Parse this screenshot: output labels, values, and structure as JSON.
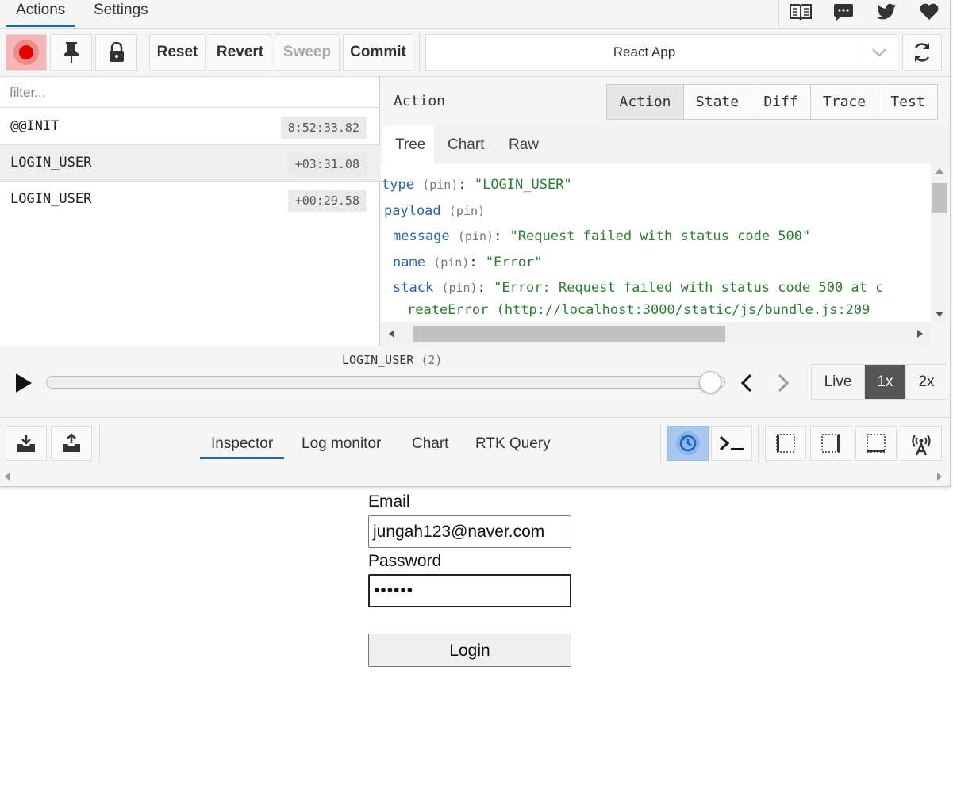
{
  "devtools": {
    "top_tabs": [
      {
        "label": "Actions",
        "active": true
      },
      {
        "label": "Settings",
        "active": false
      }
    ],
    "top_icons": [
      "book-open-icon",
      "chat-icon",
      "twitter-icon",
      "heart-icon"
    ],
    "toolbar": {
      "record_icon": "record-icon",
      "pin_icon": "pin-icon",
      "lock_icon": "lock-icon",
      "reset_label": "Reset",
      "revert_label": "Revert",
      "sweep_label": "Sweep",
      "commit_label": "Commit",
      "instance_select": "React App",
      "sync_icon": "sync-icon"
    },
    "filter_placeholder": "filter...",
    "actions": [
      {
        "name": "@@INIT",
        "time": "8:52:33.82"
      },
      {
        "name": "LOGIN_USER",
        "time": "+03:31.08"
      },
      {
        "name": "LOGIN_USER",
        "time": "+00:29.58"
      }
    ],
    "inspector": {
      "title": "Action",
      "tabs": [
        "Action",
        "State",
        "Diff",
        "Trace",
        "Test"
      ],
      "active_tab": "Action",
      "subtabs": [
        "Tree",
        "Chart",
        "Raw"
      ],
      "active_subtab": "Tree",
      "tree": {
        "type_key": "type",
        "type_value": "\"LOGIN_USER\"",
        "payload_key": "payload",
        "message_key": "message",
        "message_value": "\"Request failed with status code 500\"",
        "name_key": "name",
        "name_value": "\"Error\"",
        "stack_key": "stack",
        "stack_value_line1": "\"Error: Request failed with status code 500 at c",
        "stack_value_line2": "reateError (http://localhost:3000/static/js/bundle.js:209",
        "pin_label": "(pin)"
      }
    },
    "slider": {
      "label": "LOGIN_USER",
      "label_count": "(2)",
      "position": 1.0,
      "speeds": [
        "Live",
        "1x",
        "2x"
      ],
      "active_speed": "1x"
    },
    "bottom": {
      "monitor_tabs": [
        "Inspector",
        "Log monitor",
        "Chart",
        "RTK Query"
      ],
      "active_monitor": "Inspector",
      "left_icons": [
        "import-icon",
        "export-icon"
      ],
      "right_icons": [
        "dispatcher-icon",
        "terminal-icon",
        "slider-left-icon",
        "slider-middle-icon",
        "slider-bottom-icon",
        "remote-broadcast-icon"
      ]
    }
  },
  "login": {
    "email_label": "Email",
    "email_value": "jungah123@naver.com",
    "password_label": "Password",
    "password_value": "••••••",
    "login_label": "Login"
  }
}
